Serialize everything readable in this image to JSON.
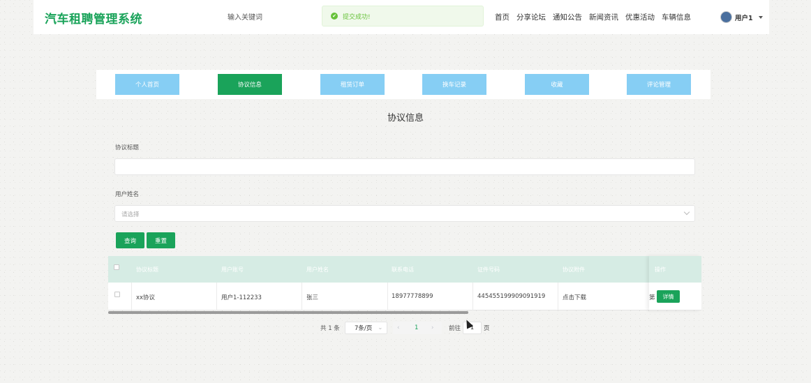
{
  "header": {
    "title": "汽车租聘管理系统",
    "search_placeholder": "输入关键词",
    "toast": "提交成功!",
    "nav": [
      "首页",
      "分享论坛",
      "通知公告",
      "新闻资讯",
      "优惠活动",
      "车辆信息"
    ],
    "user": "用户1"
  },
  "tabs": [
    "个人首页",
    "协议信息",
    "租赁订单",
    "换车记录",
    "收藏",
    "评论管理"
  ],
  "active_tab": 1,
  "page_title": "协议信息",
  "form": {
    "title_label": "协议标题",
    "title_value": "",
    "user_label": "用户姓名",
    "user_placeholder": "请选择",
    "query_btn": "查询",
    "reset_btn": "重置"
  },
  "table": {
    "headers": [
      "协议标题",
      "用户账号",
      "用户姓名",
      "联系电话",
      "证件号码",
      "协议附件",
      "",
      "操作"
    ],
    "rows": [
      {
        "title": "xx协议",
        "account": "用户1-112233",
        "name": "张三",
        "phone": "18977778899",
        "id_no": "445455199909091919",
        "attachment": "点击下载",
        "extra": "第",
        "op": "详情"
      }
    ]
  },
  "pagination": {
    "total": "共 1 条",
    "page_size": "7条/页",
    "current": "1",
    "goto_label": "前往",
    "goto_value": "1",
    "page_unit": "页"
  },
  "colors": {
    "primary": "#1aa35a",
    "tab_inactive": "#86cef4",
    "table_header": "#d6ece4",
    "toast_text": "#67c23a"
  }
}
